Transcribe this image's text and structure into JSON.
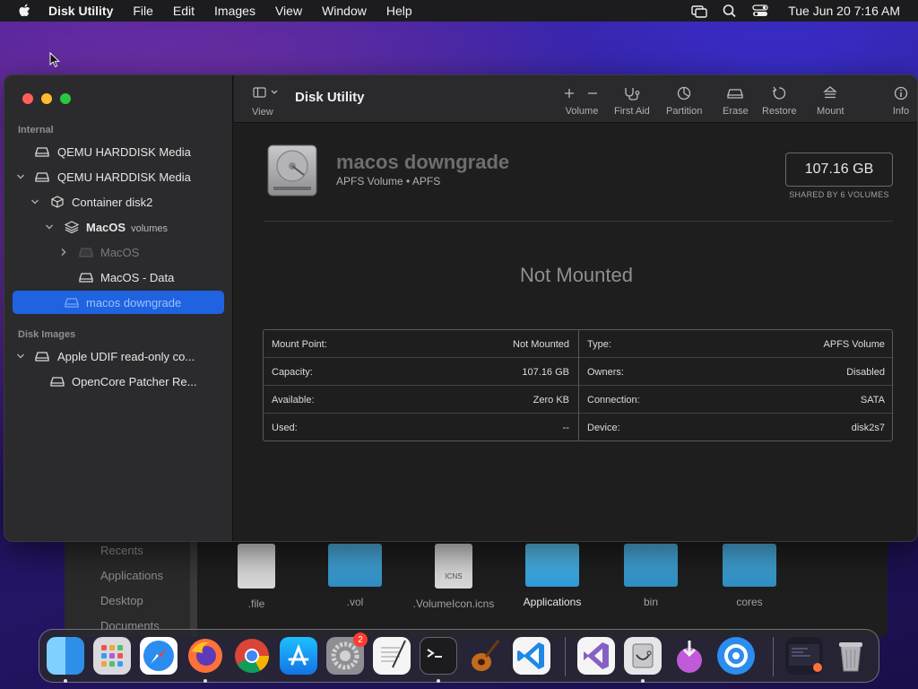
{
  "menubar": {
    "app": "Disk Utility",
    "items": [
      "File",
      "Edit",
      "Images",
      "View",
      "Window",
      "Help"
    ],
    "clock": "Tue Jun 20  7:16 AM"
  },
  "sidebar": {
    "sections": [
      "Internal",
      "Disk Images"
    ],
    "items": [
      {
        "label": "QEMU HARDDISK Media"
      },
      {
        "label": "QEMU HARDDISK Media"
      },
      {
        "label": "Container disk2"
      },
      {
        "label": "MacOS",
        "sub": "volumes"
      },
      {
        "label": "MacOS"
      },
      {
        "label": "MacOS - Data"
      },
      {
        "label": "macos downgrade"
      },
      {
        "label": "Apple UDIF read-only co..."
      },
      {
        "label": "OpenCore Patcher Re..."
      }
    ]
  },
  "toolbar": {
    "view_label": "View",
    "title": "Disk Utility",
    "volume_label": "Volume",
    "first_aid_label": "First Aid",
    "partition_label": "Partition",
    "erase_label": "Erase",
    "restore_label": "Restore",
    "mount_label": "Mount",
    "info_label": "Info"
  },
  "volume": {
    "name": "macos downgrade",
    "type": "APFS Volume • APFS",
    "size": "107.16 GB",
    "shared": "SHARED BY 6 VOLUMES",
    "status": "Not Mounted"
  },
  "info": {
    "left": [
      {
        "k": "Mount Point:",
        "v": "Not Mounted"
      },
      {
        "k": "Capacity:",
        "v": "107.16 GB"
      },
      {
        "k": "Available:",
        "v": "Zero KB"
      },
      {
        "k": "Used:",
        "v": "--"
      }
    ],
    "right": [
      {
        "k": "Type:",
        "v": "APFS Volume"
      },
      {
        "k": "Owners:",
        "v": "Disabled"
      },
      {
        "k": "Connection:",
        "v": "SATA"
      },
      {
        "k": "Device:",
        "v": "disk2s7"
      }
    ]
  },
  "finder": {
    "sidebar": [
      "Recents",
      "Applications",
      "Desktop",
      "Documents"
    ],
    "items": [
      ".file",
      ".vol",
      ".VolumeIcon.icns",
      "Applications",
      "bin",
      "cores"
    ],
    "icns_label": "ICNS"
  },
  "dock": {
    "apps": [
      "Finder",
      "Launchpad",
      "Safari",
      "Firefox",
      "Chrome",
      "App Store",
      "System Preferences",
      "TextEdit",
      "Terminal",
      "Instruments",
      "Visual Studio Code",
      "Visual Studio",
      "Disk Utility",
      "Installer",
      "Proxyman",
      "Window",
      "Trash"
    ],
    "badge": "2"
  },
  "colors": {
    "selection": "#1f63e0",
    "window_bg": "#1e1e1e",
    "sidebar_bg": "#2b2b2d"
  }
}
